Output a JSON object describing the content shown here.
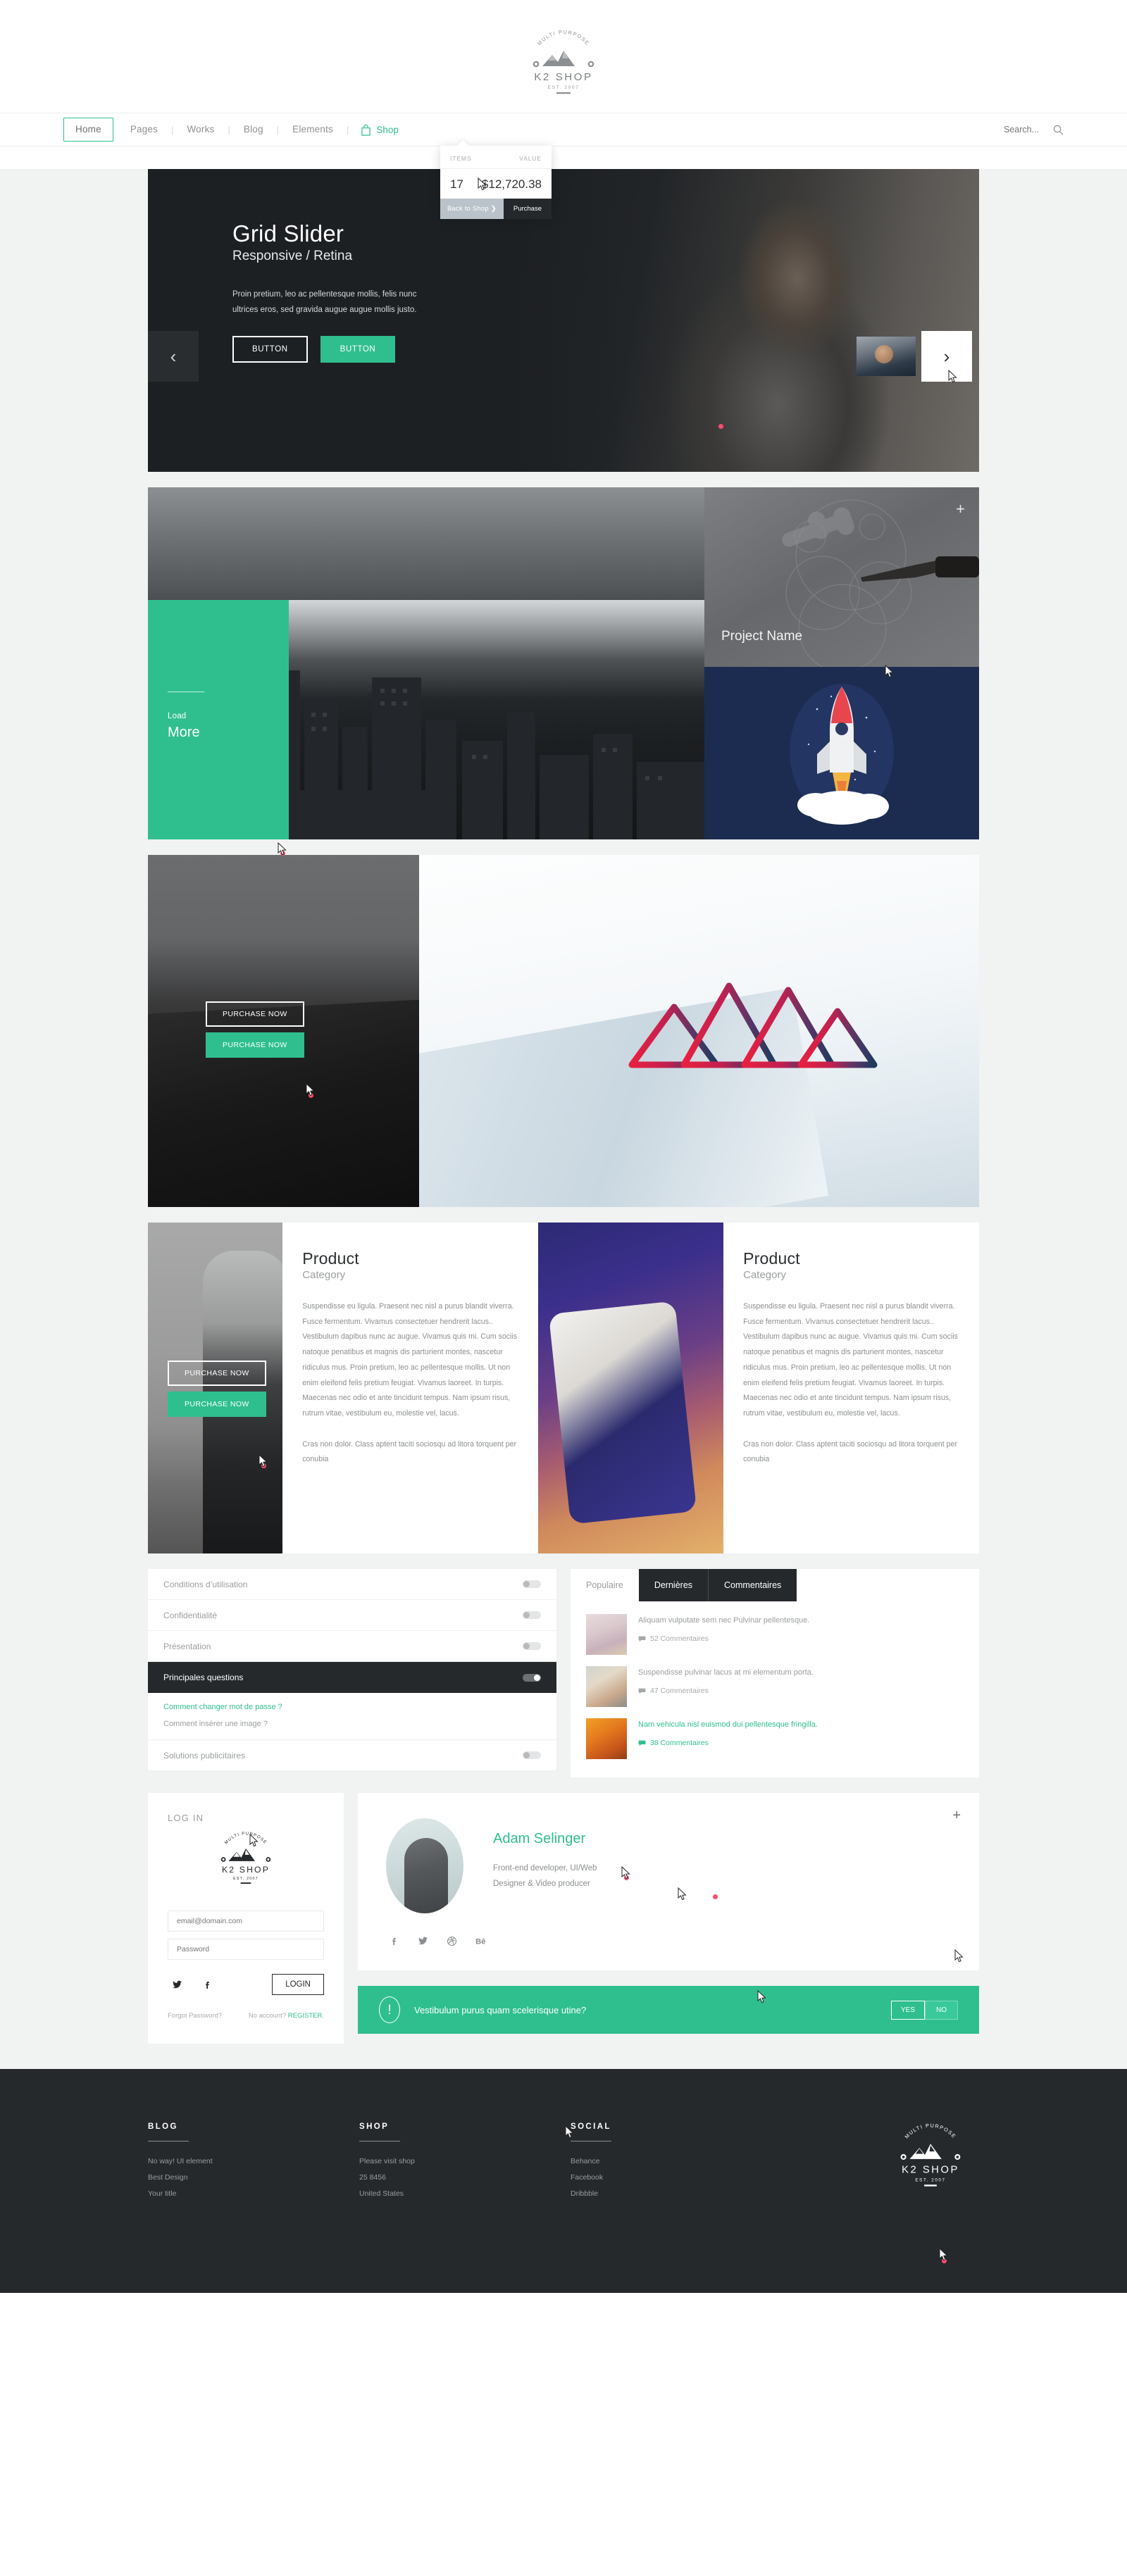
{
  "brand": {
    "arc_text": "MULTI PURPOSE",
    "name": "K2 SHOP",
    "est": "EST. 2007"
  },
  "colors": {
    "accent_green": "#2fbf8f",
    "dark": "#26292c",
    "muted": "#9a9d9e",
    "page_bg": "#f1f2f2"
  },
  "nav": {
    "items": [
      {
        "label": "Home",
        "active": true
      },
      {
        "label": "Pages",
        "active": false
      },
      {
        "label": "Works",
        "active": false
      },
      {
        "label": "Blog",
        "active": false
      },
      {
        "label": "Elements",
        "active": false
      }
    ],
    "shop_label": "Shop",
    "shop_icon": "shopping-bag-icon",
    "search": {
      "placeholder": "Search...",
      "value": "",
      "icon": "search-icon"
    }
  },
  "cart": {
    "col_items": "ITEMS",
    "col_value": "VALUE",
    "items_count": "17",
    "total_value": "$12,720.38",
    "back_label": "Back to Shop  ❯",
    "purchase_label": "Purchase"
  },
  "hero": {
    "title": "Grid Slider",
    "subtitle": "Responsive / Retina",
    "body": "Proin pretium, leo ac pellentesque mollis, felis nunc ultrices eros, sed gravida augue augue mollis justo.",
    "button_outline": "BUTTON",
    "button_filled": "BUTTON",
    "prev_icon": "chevron-left-icon",
    "next_icon": "chevron-right-icon"
  },
  "portfolio": {
    "load_small": "Load",
    "load_big": "More",
    "project_name": "Project Name",
    "plus_icon": "plus-icon"
  },
  "bag_tile": {
    "button_outline": "PURCHASE NOW",
    "button_filled": "PURCHASE NOW"
  },
  "products": [
    {
      "title": "Product",
      "category": "Category",
      "button_outline": "PURCHASE NOW",
      "button_filled": "PURCHASE NOW",
      "paragraph1": "Suspendisse eu ligula. Praesent nec nisl a purus blandit viverra. Fusce fermentum. Vivamus consectetuer hendrerit lacus.. Vestibulum dapibus nunc ac augue. Vivamus quis mi. Cum sociis natoque penatibus et magnis dis parturient montes, nascetur ridiculus mus. Proin pretium, leo ac pellentesque mollis. Ut non enim eleifend felis pretium feugiat. Vivamus laoreet. In turpis. Maecenas nec odio et ante tincidunt tempus. Nam ipsum risus, rutrum vitae, vestibulum eu, molestie vel, lacus.",
      "paragraph2": "Cras non dolor. Class aptent taciti sociosqu ad litora torquent per conubia"
    },
    {
      "title": "Product",
      "category": "Category",
      "paragraph1": "Suspendisse eu ligula. Praesent nec nisl a purus blandit viverra. Fusce fermentum. Vivamus consectetuer hendrerit lacus.. Vestibulum dapibus nunc ac augue. Vivamus quis mi. Cum sociis natoque penatibus et magnis dis parturient montes, nascetur ridiculus mus. Proin pretium, leo ac pellentesque mollis. Ut non enim eleifend felis pretium feugiat. Vivamus laoreet. In turpis. Maecenas nec odio et ante tincidunt tempus. Nam ipsum risus, rutrum vitae, vestibulum eu, molestie vel, lacus.",
      "paragraph2": "Cras non dolor. Class aptent taciti sociosqu ad litora torquent per conubia"
    }
  ],
  "accordion": {
    "rows": [
      {
        "label": "Conditions d’utilisation",
        "active": false
      },
      {
        "label": "Confidentialité",
        "active": false
      },
      {
        "label": "Présentation",
        "active": false
      },
      {
        "label": "Principales questions",
        "active": true
      },
      {
        "label": "Solutions publicitaires",
        "active": false
      }
    ],
    "panel": {
      "link": "Comment changer mot de passe ?",
      "plain": "Comment insérer une image ?"
    }
  },
  "tabs": {
    "items": [
      {
        "label": "Populaire",
        "active": false
      },
      {
        "label": "Dernières",
        "active": true
      },
      {
        "label": "Commentaires",
        "active": true
      }
    ],
    "posts": [
      {
        "text": "Aliquam vulputate sem nec Pulvinar pellentesque.",
        "comments": "52 Commentaires",
        "highlight": false
      },
      {
        "text": "Suspendisse pulvinar lacus at mi elementum porta.",
        "comments": "47 Commentaires",
        "highlight": false
      },
      {
        "text": "Nam vehicula nisl euismod dui pellentesque fringilla.",
        "comments": "38 Commentaires",
        "highlight": true
      }
    ]
  },
  "login": {
    "title": "LOG IN",
    "email_placeholder": "email@domain.com",
    "email_value": "",
    "password_placeholder": "Password",
    "password_value": "",
    "twitter_icon": "twitter-icon",
    "facebook_icon": "facebook-icon",
    "login_button": "LOGIN",
    "forgot": "Forgot Password?",
    "no_account_prefix": "No account? ",
    "register_link": "REGISTER",
    "no_account_suffix": "."
  },
  "profile": {
    "name": "Adam Selinger",
    "role_line1": "Front-end developer, UI/Web",
    "role_line2": "Designer & Video producer",
    "plus_icon": "plus-icon",
    "socials": [
      "facebook-icon",
      "twitter-icon",
      "dribbble-icon",
      "behance-icon"
    ]
  },
  "alert": {
    "icon": "exclamation-circle-icon",
    "message": "Vestibulum purus quam scelerisque utine?",
    "yes_label": "YES",
    "no_label": "NO"
  },
  "footer": {
    "columns": [
      {
        "title": "BLOG",
        "links": [
          "No way! UI element",
          "Best Design",
          "Your title"
        ]
      },
      {
        "title": "SHOP",
        "links": [
          "Please visit shop",
          "25 8456",
          "United States"
        ]
      },
      {
        "title": "SOCIAL",
        "links": [
          "Behance",
          "Facebook",
          "Dribbble"
        ]
      }
    ]
  }
}
